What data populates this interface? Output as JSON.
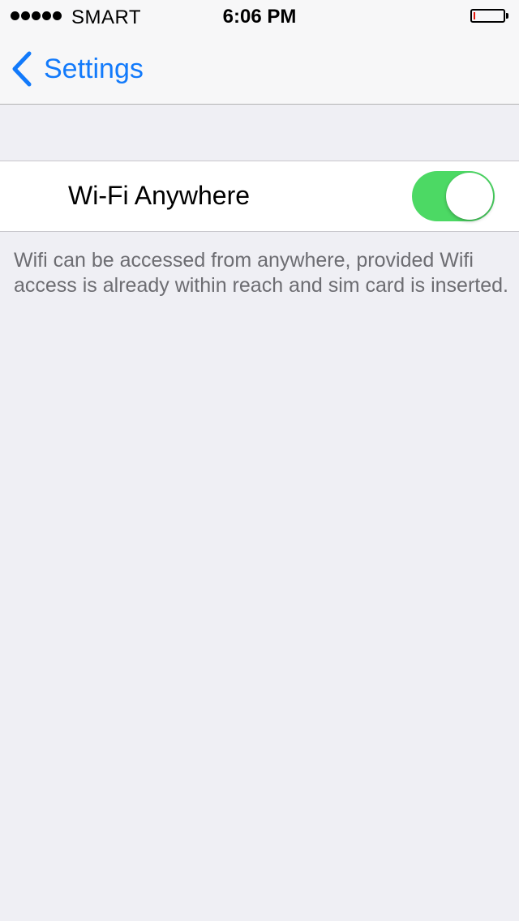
{
  "status_bar": {
    "signal_dots": 5,
    "carrier": "SMART",
    "time": "6:06 PM",
    "battery_level": 0.05,
    "battery_color": "#e3170a"
  },
  "nav": {
    "back_label": "Settings",
    "back_icon": "chevron-left-icon",
    "accent_color": "#127afb"
  },
  "setting": {
    "label": "Wi-Fi Anywhere",
    "enabled": true,
    "toggle_on_color": "#4cd964"
  },
  "footer_note": "Wifi can be accessed from anywhere, provided Wifi access is already within reach and sim card is inserted."
}
